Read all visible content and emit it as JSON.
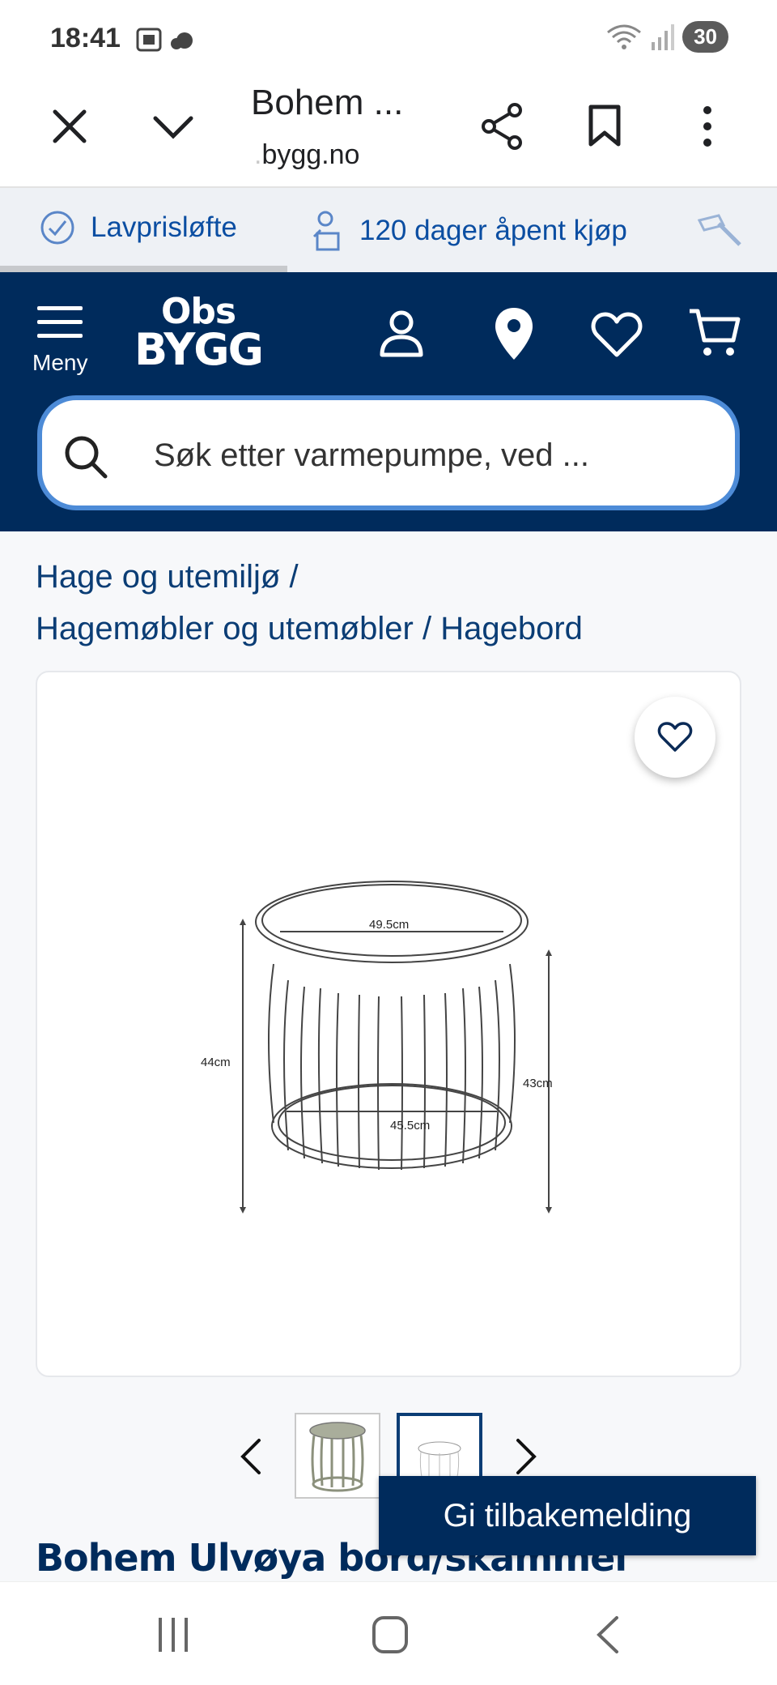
{
  "status_bar": {
    "time": "18:41",
    "battery": "30"
  },
  "browser": {
    "tab_title": "Bohem ...",
    "url_faded": ".",
    "url": "bygg.no"
  },
  "promo": {
    "item1": "Lavprisløfte",
    "item2": "120 dager åpent kjøp"
  },
  "header": {
    "menu_label": "Meny",
    "logo_line1": "Obs",
    "logo_line2": "BYGG",
    "search_placeholder": "Søk etter varmepumpe, ved ..."
  },
  "breadcrumb": {
    "crumb1": "Hage og utemiljø",
    "crumb2": "Hagemøbler og utemøbler",
    "crumb3": "Hagebord",
    "separator": "/"
  },
  "product_image": {
    "dim_top": "49.5cm",
    "dim_left": "44cm",
    "dim_right": "43cm",
    "dim_bottom": "45.5cm"
  },
  "product": {
    "title": "Bohem Ulvøya bord/skammel"
  },
  "feedback": {
    "label": "Gi tilbakemelding"
  },
  "colors": {
    "brand_navy": "#002b5c",
    "link_blue": "#0b4ea2",
    "search_border": "#4d8bd7"
  }
}
